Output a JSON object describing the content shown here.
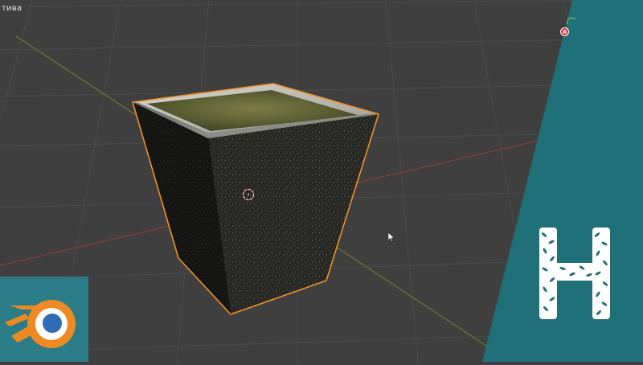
{
  "viewport": {
    "header_text": "тива",
    "background_color": "#3f3f3f",
    "grid_color": "#4a4a4a",
    "x_axis_color": "#8a3d3d",
    "y_axis_color": "#6c7a2e",
    "selection_outline_color": "#f0902a",
    "object": "pot-mesh",
    "cursor": "3d-cursor-icon"
  },
  "branding": {
    "left_logo": "blender-logo-icon",
    "right_logo": "leaf-h-logo-icon",
    "panel_color": "#20707a"
  },
  "overlay": {
    "close_icon": "close-icon"
  }
}
